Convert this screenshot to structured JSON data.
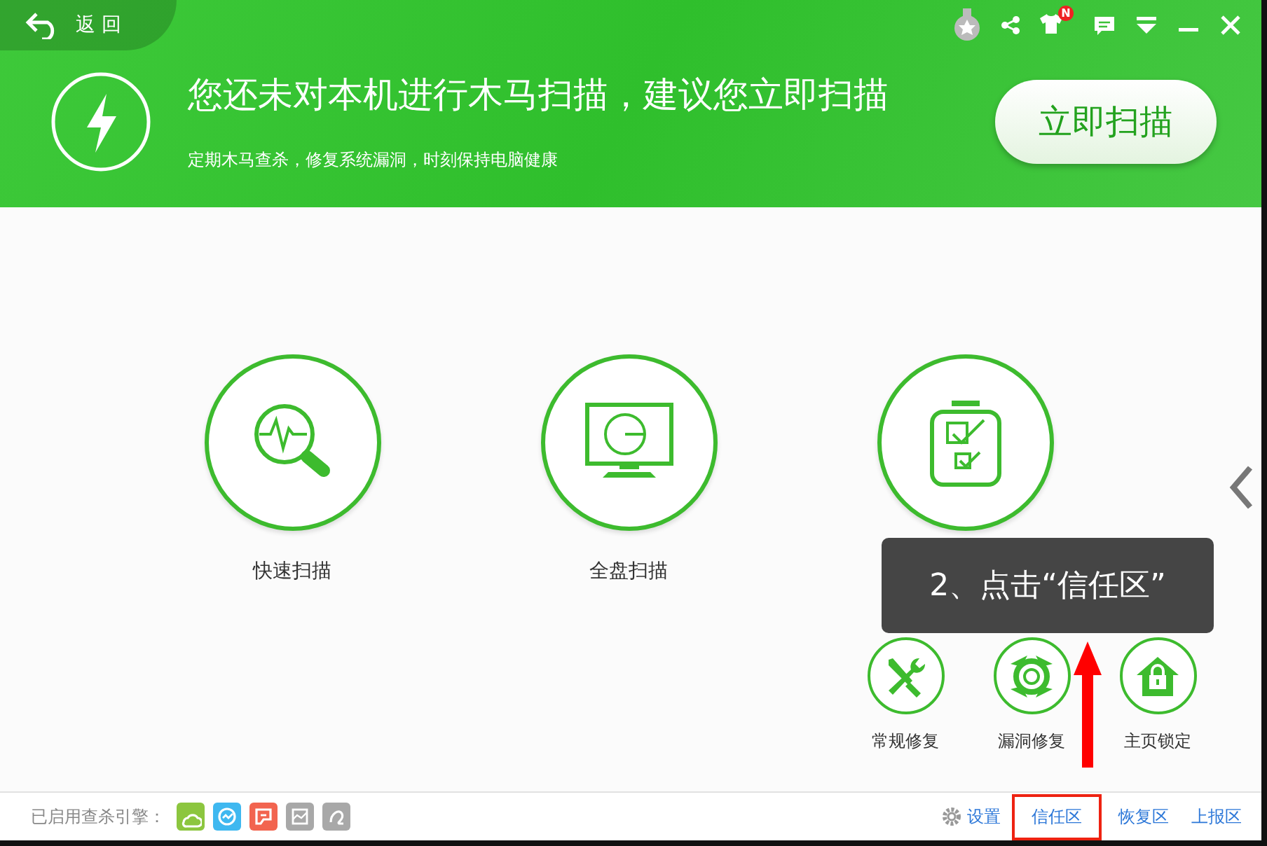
{
  "header": {
    "back_label": "返 回",
    "title": "您还未对本机进行木马扫描，建议您立即扫描",
    "subtitle": "定期木马查杀，修复系统漏洞，时刻保持电脑健康",
    "scan_button": "立即扫描",
    "skin_badge": "N"
  },
  "scan_modes": [
    {
      "kind": "quick",
      "label": "快速扫描"
    },
    {
      "kind": "full",
      "label": "全盘扫描"
    },
    {
      "kind": "custom"
    }
  ],
  "tools": [
    {
      "kind": "repair",
      "label": "常规修复"
    },
    {
      "kind": "patch",
      "label": "漏洞修复"
    },
    {
      "kind": "lock",
      "label": "主页锁定"
    }
  ],
  "tooltip": "2、点击“信任区”",
  "footer": {
    "engines_label": "已启用查杀引擎：",
    "engines": [
      {
        "kind": "cloud",
        "color": "#8cc63f"
      },
      {
        "kind": "check",
        "color": "#3fb8f0"
      },
      {
        "kind": "frame",
        "color": "#f2644f"
      },
      {
        "kind": "picture",
        "color": "#a8a8a8"
      },
      {
        "kind": "swirl",
        "color": "#a8a8a8"
      }
    ],
    "settings": "设置",
    "links": [
      {
        "label": "信任区",
        "highlighted": true
      },
      {
        "label": "恢复区",
        "highlighted": false
      },
      {
        "label": "上报区",
        "highlighted": false
      }
    ]
  }
}
